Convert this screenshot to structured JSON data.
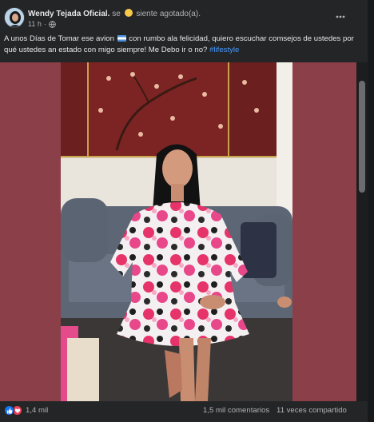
{
  "post": {
    "author": "Wendy Tejada Oficial",
    "feeling_prefix": "se",
    "feeling_text": "siente agotado(a).",
    "time": "11 h",
    "text_before_flag": "A unos Días de Tomar ese avion",
    "text_after_flag": "con rumbo ala felicidad, quiero escuchar comsejos de ustedes por qué ustedes an estado con migo siempre! Me Debo ir o no?",
    "hashtag": "#lifestyle"
  },
  "footer": {
    "reaction_count": "1,4 mil",
    "comments": "1,5 mil comentarios",
    "shares": "11 veces compartido"
  },
  "colors": {
    "card_bg": "#242526",
    "media_bg": "#8a3f49",
    "link": "#4599ff",
    "like": "#1877f2",
    "love": "#f33e58"
  },
  "icons": [
    "globe-icon",
    "more-options-icon",
    "tired-face-emoji",
    "flag-emoji",
    "like-reaction-icon",
    "love-reaction-icon"
  ]
}
